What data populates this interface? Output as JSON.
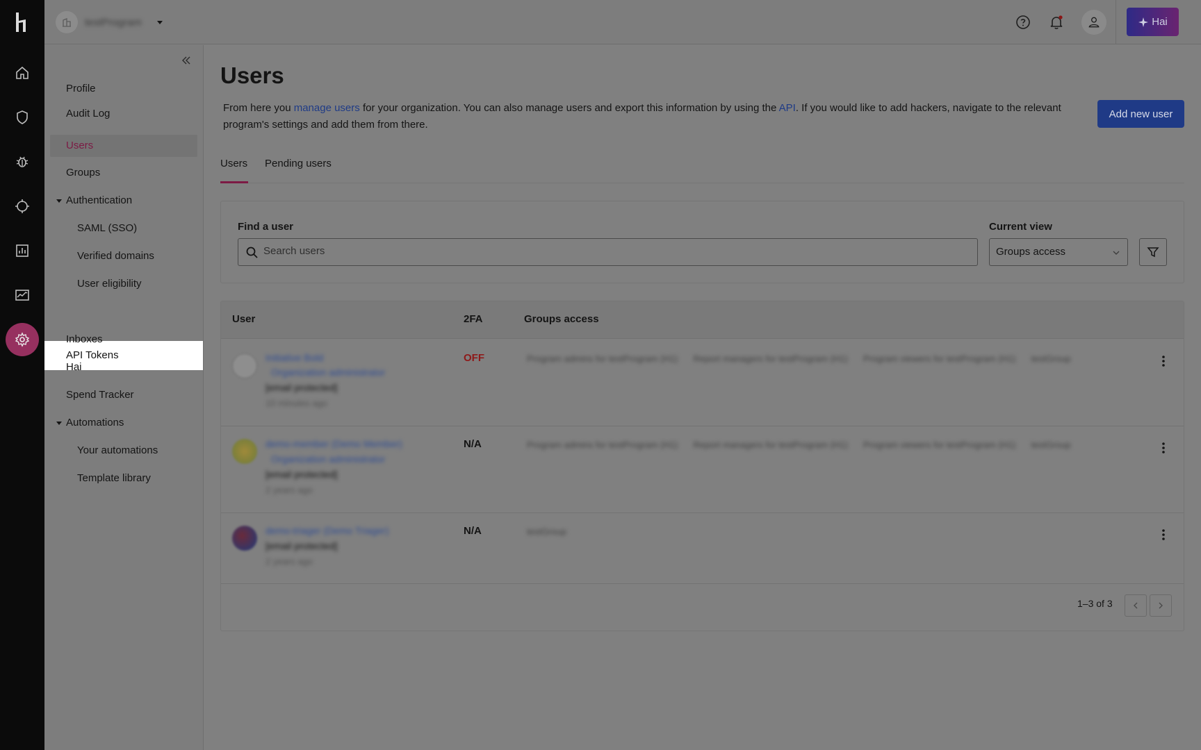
{
  "topbar": {
    "org_name": "testProgram",
    "hai_label": "Hai"
  },
  "sidebar": {
    "items": [
      {
        "label": "Profile"
      },
      {
        "label": "Audit Log"
      },
      {
        "label": "Users"
      },
      {
        "label": "Groups"
      },
      {
        "label": "Authentication"
      },
      {
        "label": "SAML (SSO)"
      },
      {
        "label": "Verified domains"
      },
      {
        "label": "User eligibility"
      },
      {
        "label": "API Tokens"
      },
      {
        "label": "Inboxes"
      },
      {
        "label": "Hai"
      },
      {
        "label": "Spend Tracker"
      },
      {
        "label": "Automations"
      },
      {
        "label": "Your automations"
      },
      {
        "label": "Template library"
      }
    ]
  },
  "main": {
    "title": "Users",
    "intro_1": "From here you ",
    "intro_link_1": "manage users",
    "intro_2": " for your organization. You can also manage users and export this information by using the ",
    "intro_link_2": "API",
    "intro_3": ". If you would like to add hackers, navigate to the relevant program's settings and add them from there.",
    "add_user_label": "Add new user",
    "tabs": [
      {
        "label": "Users"
      },
      {
        "label": "Pending users"
      }
    ],
    "search": {
      "label": "Find a user",
      "placeholder": "Search users",
      "view_label": "Current view",
      "view_value": "Groups access"
    },
    "table": {
      "headers": {
        "user": "User",
        "twofa": "2FA",
        "groups": "Groups access"
      },
      "rows": [
        {
          "name": "Initiative Bold",
          "badge": "Organization administrator",
          "email": "[email protected]",
          "time": "10 minutes ago",
          "twofa": "OFF",
          "groups": [
            "Program admins for testProgram (H1)",
            "Report managers for testProgram (H1)",
            "Program viewers for testProgram (H1)",
            "testGroup"
          ]
        },
        {
          "name": "demo-member (Demo Member)",
          "badge": "Organization administrator",
          "email": "[email protected]",
          "time": "2 years ago",
          "twofa": "N/A",
          "groups": [
            "Program admins for testProgram (H1)",
            "Report managers for testProgram (H1)",
            "Program viewers for testProgram (H1)",
            "testGroup"
          ]
        },
        {
          "name": "demo-triager (Demo Triager)",
          "email": "[email protected]",
          "time": "2 years ago",
          "twofa": "N/A",
          "groups": [
            "testGroup"
          ]
        }
      ],
      "pagination": "1–3 of 3"
    }
  }
}
